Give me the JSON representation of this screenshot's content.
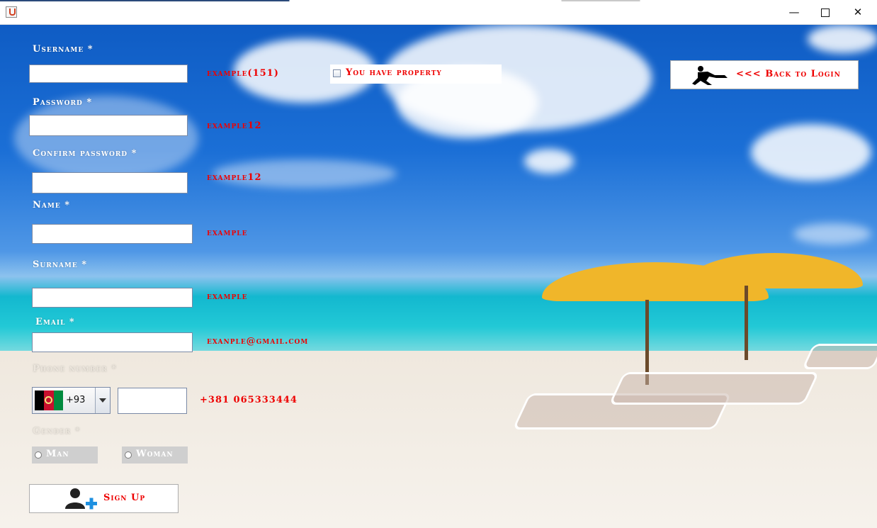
{
  "window": {
    "minimize_glyph": "—",
    "close_glyph": "✕"
  },
  "form": {
    "username": {
      "label": "Username *",
      "value": "",
      "hint": "example(151)"
    },
    "password": {
      "label": "Password *",
      "value": "",
      "hint": "example12"
    },
    "confirm_password": {
      "label": "Confirm password *",
      "value": "",
      "hint": "example12"
    },
    "name": {
      "label": "Name *",
      "value": "",
      "hint": "example"
    },
    "surname": {
      "label": "Surname *",
      "value": "",
      "hint": "example"
    },
    "email": {
      "label": "Email *",
      "value": "",
      "hint": "exanple@gmail.com"
    },
    "phone": {
      "label": "Phone number *",
      "country_code": "+93",
      "value": "",
      "hint": "+381 065333444"
    },
    "gender": {
      "label": "Gender *",
      "option_man": "Man",
      "option_woman": "Woman",
      "selected": ""
    },
    "property_checkbox": {
      "label": "You have property",
      "checked": false
    }
  },
  "buttons": {
    "back_to_login": "<<< Back to Login",
    "sign_up": "Sign Up"
  },
  "icons": {
    "back": "runner-icon",
    "sign_up": "add-user-icon",
    "window": "java-icon"
  },
  "colors": {
    "hint_text": "#ee0000",
    "label_text": "#ffffff",
    "sign_up_plus": "#1e90e0"
  }
}
